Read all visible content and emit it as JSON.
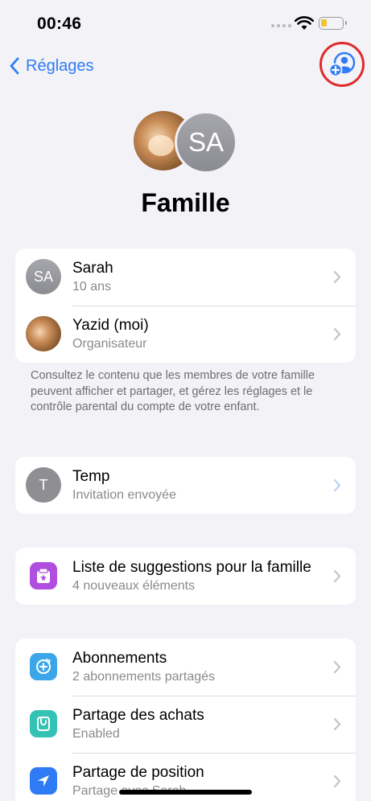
{
  "status_bar": {
    "time": "00:46",
    "battery_level": 0.2
  },
  "nav": {
    "back_label": "Réglages"
  },
  "header": {
    "avatar_initials": "SA",
    "title": "Famille"
  },
  "members": [
    {
      "initials": "SA",
      "name": "Sarah",
      "detail": "10 ans"
    },
    {
      "name": "Yazid (moi)",
      "detail": "Organisateur"
    }
  ],
  "members_footer": "Consultez le contenu que les membres de votre famille peuvent afficher et partager, et gérez les réglages et le contrôle parental du compte de votre enfant.",
  "pending": {
    "initials": "T",
    "name": "Temp",
    "detail": "Invitation envoyée"
  },
  "suggestions": {
    "title": "Liste de suggestions pour la famille",
    "detail": "4 nouveaux éléments",
    "icon": "family-checklist-icon",
    "color": "#b04ee0"
  },
  "features": [
    {
      "title": "Abonnements",
      "detail": "2 abonnements partagés",
      "icon": "subscriptions-icon",
      "color": "#3ba6e8"
    },
    {
      "title": "Partage des achats",
      "detail": "Enabled",
      "icon": "purchase-sharing-icon",
      "color": "#33c2b4"
    },
    {
      "title": "Partage de position",
      "detail": "Partage avec Sarah",
      "icon": "location-arrow-icon",
      "color": "#2f7bf6"
    }
  ],
  "colors": {
    "accent": "#2f7bf6",
    "highlight_ring": "#e02a2a",
    "background": "#f2f2f7"
  }
}
